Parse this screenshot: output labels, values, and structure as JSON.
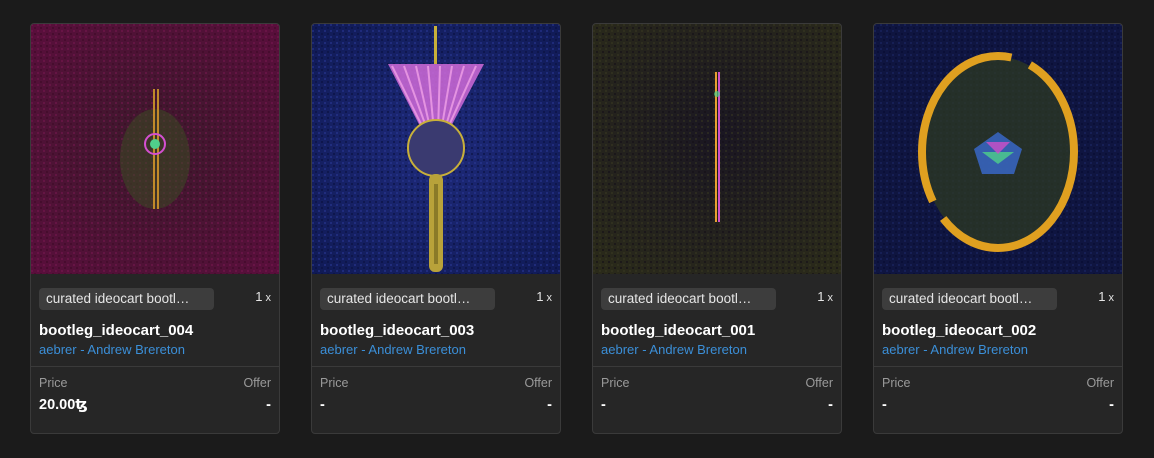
{
  "cards": [
    {
      "collection": "curated ideocart bootl…",
      "quantity": "1",
      "quantity_suffix": "x",
      "title": "bootleg_ideocart_004",
      "artist": "aebrer - Andrew Brereton",
      "price_label": "Price",
      "offer_label": "Offer",
      "price": "20.00ꜩ",
      "offer": "-"
    },
    {
      "collection": "curated ideocart bootl…",
      "quantity": "1",
      "quantity_suffix": "x",
      "title": "bootleg_ideocart_003",
      "artist": "aebrer - Andrew Brereton",
      "price_label": "Price",
      "offer_label": "Offer",
      "price": "-",
      "offer": "-"
    },
    {
      "collection": "curated ideocart bootl…",
      "quantity": "1",
      "quantity_suffix": "x",
      "title": "bootleg_ideocart_001",
      "artist": "aebrer - Andrew Brereton",
      "price_label": "Price",
      "offer_label": "Offer",
      "price": "-",
      "offer": "-"
    },
    {
      "collection": "curated ideocart bootl…",
      "quantity": "1",
      "quantity_suffix": "x",
      "title": "bootleg_ideocart_002",
      "artist": "aebrer - Andrew Brereton",
      "price_label": "Price",
      "offer_label": "Offer",
      "price": "-",
      "offer": "-"
    }
  ],
  "colors": {
    "background": "#1b1b1b",
    "card": "#262626",
    "artist_link": "#3b8fd8"
  }
}
